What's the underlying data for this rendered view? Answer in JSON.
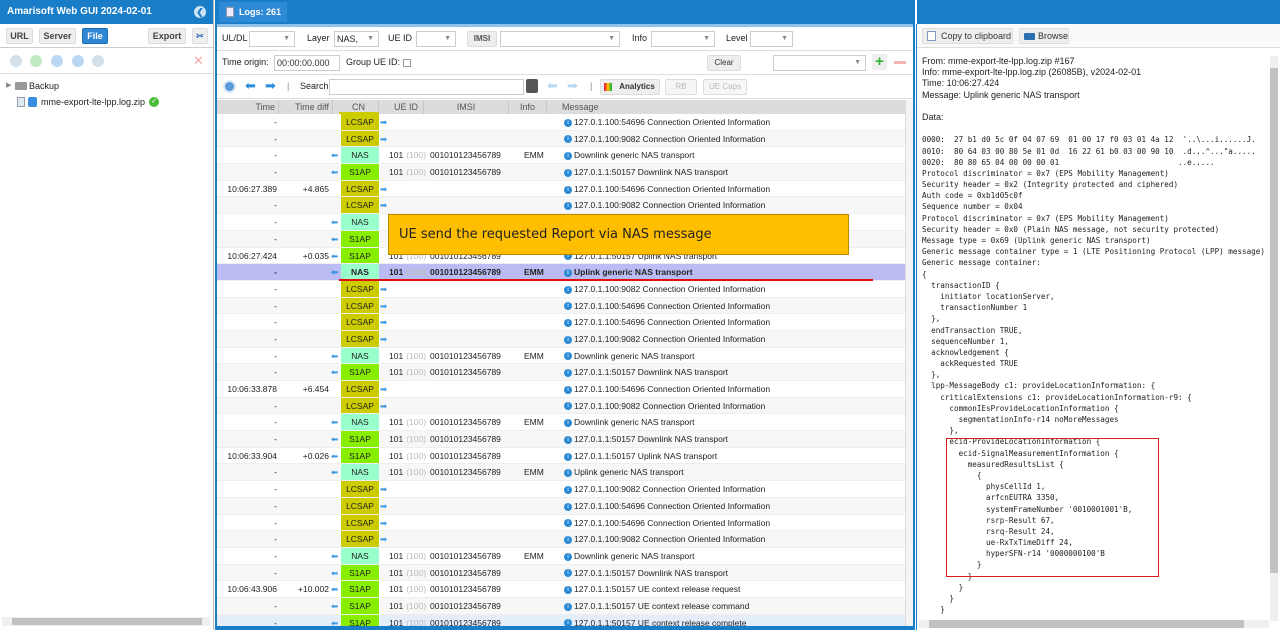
{
  "app": {
    "title": "Amarisoft Web GUI 2024-02-01"
  },
  "left": {
    "tabs": [
      {
        "label": "URL"
      },
      {
        "label": "Server"
      },
      {
        "label": "File",
        "active": true
      }
    ],
    "export_label": "Export",
    "tools": [
      "wrench-icon",
      "check-icon",
      "refresh-icon",
      "play-icon",
      "scissors-icon",
      "close-icon"
    ],
    "tree": [
      {
        "label": "Backup",
        "type": "folder"
      },
      {
        "label": "mme-export-lte-lpp.log.zip",
        "type": "file",
        "status": "ok"
      }
    ]
  },
  "center": {
    "tab_label": "Logs: 261",
    "filters": {
      "uldl_label": "UL/DL",
      "uldl_value": "",
      "layer_label": "Layer",
      "layer_value": "NAS,",
      "ueid_label": "UE ID",
      "ueid_value": "",
      "imsi_button": "IMSI",
      "imsi_value": "",
      "info_label": "Info",
      "info_value": "",
      "level_label": "Level",
      "level_value": ""
    },
    "row2": {
      "time_origin_label": "Time origin:",
      "time_origin_value": "00:00:00.000",
      "group_ue_label": "Group UE ID:",
      "group_ue_checked": false,
      "clear_label": "Clear",
      "preset_value": ""
    },
    "toolbar": {
      "search_label": "Search",
      "search_value": "",
      "analytics_label": "Analytics",
      "rb_label": "RB",
      "uecaps_label": "UE Caps"
    },
    "columns": [
      "Time",
      "Time diff",
      "CN",
      "UE ID",
      "IMSI",
      "Info",
      "Message"
    ],
    "rows": [
      {
        "time": "-",
        "diff": "",
        "dir": "R",
        "cn": "LCSAP",
        "ue": "",
        "ue2": "",
        "imsi": "",
        "info": "",
        "msg": "127.0.1.100:54696 Connection Oriented Information"
      },
      {
        "time": "-",
        "diff": "",
        "dir": "R",
        "cn": "LCSAP",
        "ue": "",
        "ue2": "",
        "imsi": "",
        "info": "",
        "msg": "127.0.1.100:9082 Connection Oriented Information"
      },
      {
        "time": "-",
        "diff": "",
        "dir": "L",
        "cn": "NAS",
        "ue": "101",
        "ue2": "(100)",
        "imsi": "001010123456789",
        "info": "EMM",
        "msg": "Downlink generic NAS transport"
      },
      {
        "time": "-",
        "diff": "",
        "dir": "L",
        "cn": "S1AP",
        "ue": "101",
        "ue2": "(100)",
        "imsi": "001010123456789",
        "info": "",
        "msg": "127.0.1.1:50157 Downlink NAS transport"
      },
      {
        "time": "10:06:27.389",
        "diff": "+4.865",
        "dir": "R",
        "cn": "LCSAP",
        "ue": "",
        "ue2": "",
        "imsi": "",
        "info": "",
        "msg": "127.0.1.100:54696 Connection Oriented Information"
      },
      {
        "time": "-",
        "diff": "",
        "dir": "R",
        "cn": "LCSAP",
        "ue": "",
        "ue2": "",
        "imsi": "",
        "info": "",
        "msg": "127.0.1.100:9082 Connection Oriented Information"
      },
      {
        "time": "-",
        "diff": "",
        "dir": "L",
        "cn": "NAS",
        "ue": "",
        "ue2": "",
        "imsi": "",
        "info": "",
        "msg": ""
      },
      {
        "time": "-",
        "diff": "",
        "dir": "L",
        "cn": "S1AP",
        "ue": "",
        "ue2": "",
        "imsi": "",
        "info": "",
        "msg": ""
      },
      {
        "time": "10:06:27.424",
        "diff": "+0.035",
        "dir": "L",
        "cn": "S1AP",
        "ue": "101",
        "ue2": "(100)",
        "imsi": "001010123456789",
        "info": "",
        "msg": "127.0.1.1:50157 Uplink NAS transport"
      },
      {
        "time": "-",
        "diff": "",
        "dir": "L",
        "cn": "NAS",
        "ue": "101",
        "ue2": "(100)",
        "imsi": "001010123456789",
        "info": "EMM",
        "msg": "Uplink generic NAS transport",
        "selected": true
      },
      {
        "time": "-",
        "diff": "",
        "dir": "R",
        "cn": "LCSAP",
        "ue": "",
        "ue2": "",
        "imsi": "",
        "info": "",
        "msg": "127.0.1.100:9082 Connection Oriented Information"
      },
      {
        "time": "-",
        "diff": "",
        "dir": "R",
        "cn": "LCSAP",
        "ue": "",
        "ue2": "",
        "imsi": "",
        "info": "",
        "msg": "127.0.1.100:54696 Connection Oriented Information"
      },
      {
        "time": "-",
        "diff": "",
        "dir": "R",
        "cn": "LCSAP",
        "ue": "",
        "ue2": "",
        "imsi": "",
        "info": "",
        "msg": "127.0.1.100:54696 Connection Oriented Information"
      },
      {
        "time": "-",
        "diff": "",
        "dir": "R",
        "cn": "LCSAP",
        "ue": "",
        "ue2": "",
        "imsi": "",
        "info": "",
        "msg": "127.0.1.100:9082 Connection Oriented Information"
      },
      {
        "time": "-",
        "diff": "",
        "dir": "L",
        "cn": "NAS",
        "ue": "101",
        "ue2": "(100)",
        "imsi": "001010123456789",
        "info": "EMM",
        "msg": "Downlink generic NAS transport"
      },
      {
        "time": "-",
        "diff": "",
        "dir": "L",
        "cn": "S1AP",
        "ue": "101",
        "ue2": "(100)",
        "imsi": "001010123456789",
        "info": "",
        "msg": "127.0.1.1:50157 Downlink NAS transport"
      },
      {
        "time": "10:06:33.878",
        "diff": "+6.454",
        "dir": "R",
        "cn": "LCSAP",
        "ue": "",
        "ue2": "",
        "imsi": "",
        "info": "",
        "msg": "127.0.1.100:54696 Connection Oriented Information"
      },
      {
        "time": "-",
        "diff": "",
        "dir": "R",
        "cn": "LCSAP",
        "ue": "",
        "ue2": "",
        "imsi": "",
        "info": "",
        "msg": "127.0.1.100:9082 Connection Oriented Information"
      },
      {
        "time": "-",
        "diff": "",
        "dir": "L",
        "cn": "NAS",
        "ue": "101",
        "ue2": "(100)",
        "imsi": "001010123456789",
        "info": "EMM",
        "msg": "Downlink generic NAS transport"
      },
      {
        "time": "-",
        "diff": "",
        "dir": "L",
        "cn": "S1AP",
        "ue": "101",
        "ue2": "(100)",
        "imsi": "001010123456789",
        "info": "",
        "msg": "127.0.1.1:50157 Downlink NAS transport"
      },
      {
        "time": "10:06:33.904",
        "diff": "+0.026",
        "dir": "L",
        "cn": "S1AP",
        "ue": "101",
        "ue2": "(100)",
        "imsi": "001010123456789",
        "info": "",
        "msg": "127.0.1.1:50157 Uplink NAS transport"
      },
      {
        "time": "-",
        "diff": "",
        "dir": "L",
        "cn": "NAS",
        "ue": "101",
        "ue2": "(100)",
        "imsi": "001010123456789",
        "info": "EMM",
        "msg": "Uplink generic NAS transport"
      },
      {
        "time": "-",
        "diff": "",
        "dir": "R",
        "cn": "LCSAP",
        "ue": "",
        "ue2": "",
        "imsi": "",
        "info": "",
        "msg": "127.0.1.100:9082 Connection Oriented Information"
      },
      {
        "time": "-",
        "diff": "",
        "dir": "R",
        "cn": "LCSAP",
        "ue": "",
        "ue2": "",
        "imsi": "",
        "info": "",
        "msg": "127.0.1.100:54696 Connection Oriented Information"
      },
      {
        "time": "-",
        "diff": "",
        "dir": "R",
        "cn": "LCSAP",
        "ue": "",
        "ue2": "",
        "imsi": "",
        "info": "",
        "msg": "127.0.1.100:54696 Connection Oriented Information"
      },
      {
        "time": "-",
        "diff": "",
        "dir": "R",
        "cn": "LCSAP",
        "ue": "",
        "ue2": "",
        "imsi": "",
        "info": "",
        "msg": "127.0.1.100:9082 Connection Oriented Information"
      },
      {
        "time": "-",
        "diff": "",
        "dir": "L",
        "cn": "NAS",
        "ue": "101",
        "ue2": "(100)",
        "imsi": "001010123456789",
        "info": "EMM",
        "msg": "Downlink generic NAS transport"
      },
      {
        "time": "-",
        "diff": "",
        "dir": "L",
        "cn": "S1AP",
        "ue": "101",
        "ue2": "(100)",
        "imsi": "001010123456789",
        "info": "",
        "msg": "127.0.1.1:50157 Downlink NAS transport"
      },
      {
        "time": "10:06:43.906",
        "diff": "+10.002",
        "dir": "L",
        "cn": "S1AP",
        "ue": "101",
        "ue2": "(100)",
        "imsi": "001010123456789",
        "info": "",
        "msg": "127.0.1.1:50157 UE context release request"
      },
      {
        "time": "-",
        "diff": "",
        "dir": "L",
        "cn": "S1AP",
        "ue": "101",
        "ue2": "(100)",
        "imsi": "001010123456789",
        "info": "",
        "msg": "127.0.1.1:50157 UE context release command"
      },
      {
        "time": "-",
        "diff": "",
        "dir": "L",
        "cn": "S1AP",
        "ue": "101",
        "ue2": "(100)",
        "imsi": "001010123456789",
        "info": "",
        "msg": "127.0.1.1:50157 UE context release complete",
        "last": true
      }
    ],
    "callout": "UE send the requested Report via NAS message",
    "cn_colors": {
      "LCSAP": "#cccc00",
      "NAS": "#99ffcc",
      "S1AP": "#88ee00"
    }
  },
  "right": {
    "copy_label": "Copy to clipboard",
    "browse_label": "Browse",
    "header_lines": [
      "From: mme-export-lte-lpp.log.zip #167",
      "Info: mme-export-lte-lpp.log.zip (26085B), v2024-02-01",
      "Time: 10:06:27.424",
      "Message: Uplink generic NAS transport",
      "",
      "Data:",
      ""
    ],
    "mono_lines": [
      "0000:  27 b1 d0 5c 0f 04 07 69  01 00 17 f0 03 01 4a 12  '..\\...i......J.",
      "0010:  80 64 03 00 80 5e 01 0d  16 22 61 b0 03 00 90 10  .d...^...\"a.....",
      "0020:  80 80 65 04 00 00 00 01                          ..e.....",
      "Protocol discriminator = 0x7 (EPS Mobility Management)",
      "Security header = 0x2 (Integrity protected and ciphered)",
      "Auth code = 0xb1d05c0f",
      "Sequence number = 0x04",
      "Protocol discriminator = 0x7 (EPS Mobility Management)",
      "Security header = 0x0 (Plain NAS message, not security protected)",
      "Message type = 0x69 (Uplink generic NAS transport)",
      "Generic message container type = 1 (LTE Positioning Protocol (LPP) message)",
      "Generic message container:",
      "{",
      "  transactionID {",
      "    initiator locationServer,",
      "    transactionNumber 1",
      "  },",
      "  endTransaction TRUE,",
      "  sequenceNumber 1,",
      "  acknowledgement {",
      "    ackRequested TRUE",
      "  },",
      "  lpp-MessageBody c1: provideLocationInformation: {",
      "    criticalExtensions c1: provideLocationInformation-r9: {",
      "      commonIEsProvideLocationInformation {",
      "        segmentationInfo-r14 noMoreMessages",
      "      },",
      "      ecid-ProvideLocationInformation {",
      "        ecid-SignalMeasurementInformation {",
      "          measuredResultsList {",
      "            {",
      "              physCellId 1,",
      "              arfcnEUTRA 3350,",
      "              systemFrameNumber '0010001001'B,",
      "              rsrp-Result 67,",
      "              rsrq-Result 24,",
      "              ue-RxTxTimeDiff 24,",
      "              hyperSFN-r14 '0000000100'B",
      "            }",
      "          }",
      "        }",
      "      }",
      "    }"
    ]
  }
}
